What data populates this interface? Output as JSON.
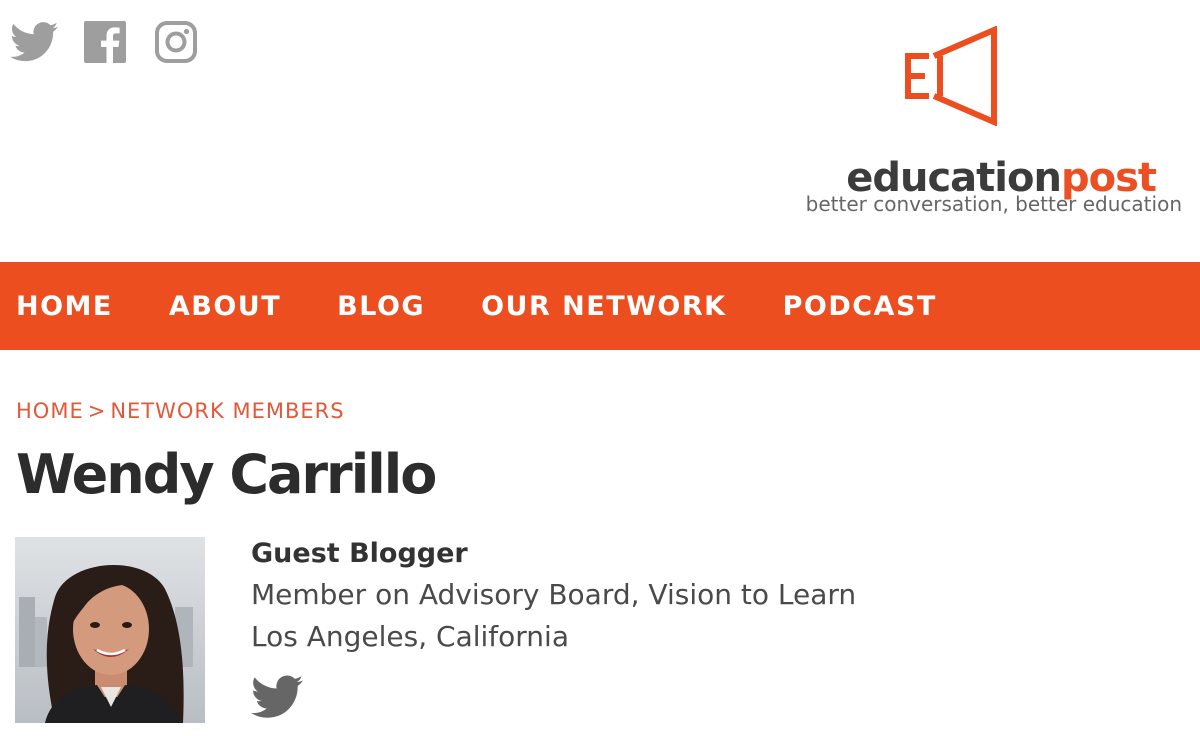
{
  "social": {
    "twitter_icon": "twitter-icon",
    "facebook_icon": "facebook-icon",
    "instagram_icon": "instagram-icon"
  },
  "brand": {
    "name_part1": "education",
    "name_part2": "post",
    "tagline": "better conversation, better education",
    "accent_color": "#ec4e20"
  },
  "nav": {
    "items": [
      {
        "label": "HOME"
      },
      {
        "label": "ABOUT"
      },
      {
        "label": "BLOG"
      },
      {
        "label": "OUR NETWORK"
      },
      {
        "label": "PODCAST"
      }
    ]
  },
  "breadcrumb": {
    "home": "HOME",
    "separator": ">",
    "current": "NETWORK MEMBERS"
  },
  "profile": {
    "name": "Wendy Carrillo",
    "role": "Guest Blogger",
    "affiliation": "Member on Advisory Board, Vision to Learn",
    "location": "Los Angeles, California",
    "twitter_icon": "twitter-icon"
  }
}
